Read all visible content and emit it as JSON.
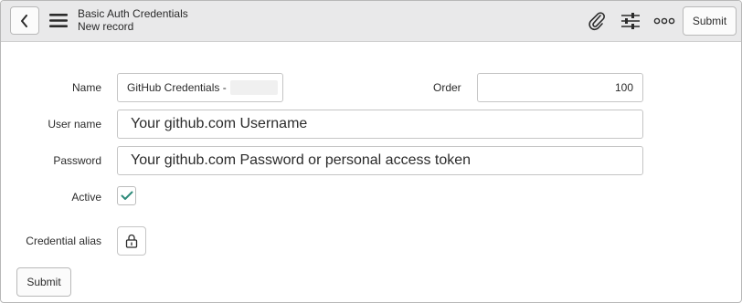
{
  "header": {
    "title": "Basic Auth Credentials",
    "subtitle": "New record",
    "back_icon": "chevron-left-icon",
    "menu_icon": "hamburger-icon",
    "attach_icon": "paperclip-icon",
    "settings_icon": "sliders-icon",
    "more_icon": "more-horizontal-icon",
    "submit_label": "Submit"
  },
  "form": {
    "name_label": "Name",
    "name_value": "GitHub Credentials -",
    "order_label": "Order",
    "order_value": "100",
    "username_label": "User name",
    "username_value": "Your github.com Username",
    "password_label": "Password",
    "password_value": "Your github.com Password or personal access token",
    "active_label": "Active",
    "active_checked": true,
    "alias_label": "Credential alias",
    "alias_icon": "lock-icon",
    "submit_label": "Submit"
  },
  "colors": {
    "header_bg": "#e9e9ea",
    "check_color": "#2e8b7a"
  }
}
